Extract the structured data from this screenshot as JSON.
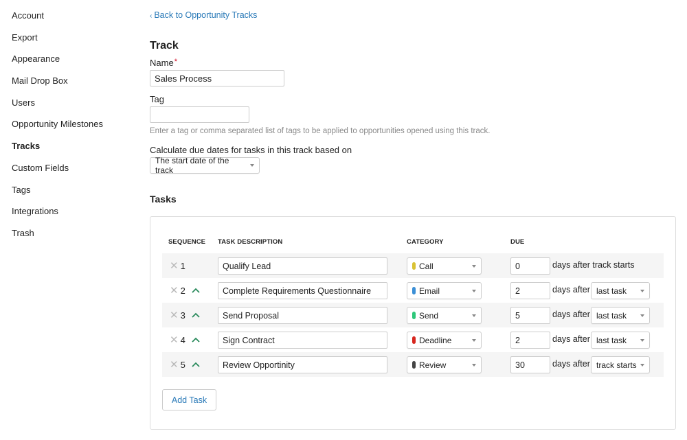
{
  "sidebar": {
    "items": [
      {
        "label": "Account",
        "active": false
      },
      {
        "label": "Export",
        "active": false
      },
      {
        "label": "Appearance",
        "active": false
      },
      {
        "label": "Mail Drop Box",
        "active": false
      },
      {
        "label": "Users",
        "active": false
      },
      {
        "label": "Opportunity Milestones",
        "active": false
      },
      {
        "label": "Tracks",
        "active": true
      },
      {
        "label": "Custom Fields",
        "active": false
      },
      {
        "label": "Tags",
        "active": false
      },
      {
        "label": "Integrations",
        "active": false
      },
      {
        "label": "Trash",
        "active": false
      }
    ]
  },
  "back_link": {
    "chevron": "‹",
    "label": "Back to Opportunity Tracks"
  },
  "form": {
    "heading": "Track",
    "name_label": "Name",
    "required_mark": "*",
    "name_value": "Sales Process",
    "tag_label": "Tag",
    "tag_value": "",
    "tag_help": "Enter a tag or comma separated list of tags to be applied to opportunities opened using this track.",
    "due_basis_label": "Calculate due dates for tasks in this track based on",
    "due_basis_value": "The start date of the track"
  },
  "tasks": {
    "heading": "Tasks",
    "columns": {
      "sequence": "SEQUENCE",
      "description": "TASK DESCRIPTION",
      "category": "CATEGORY",
      "due": "DUE"
    },
    "rows": [
      {
        "seq": "1",
        "description": "Qualify Lead",
        "category": "Call",
        "category_color": "#d9c234",
        "due_days": "0",
        "due_text": "days after track starts",
        "relative_to": null,
        "can_move_up": false
      },
      {
        "seq": "2",
        "description": "Complete Requirements Questionnaire",
        "category": "Email",
        "category_color": "#3b8fd6",
        "due_days": "2",
        "due_text": "days after",
        "relative_to": "last task",
        "can_move_up": true
      },
      {
        "seq": "3",
        "description": "Send Proposal",
        "category": "Send",
        "category_color": "#2ec77a",
        "due_days": "5",
        "due_text": "days after",
        "relative_to": "last task",
        "can_move_up": true
      },
      {
        "seq": "4",
        "description": "Sign Contract",
        "category": "Deadline",
        "category_color": "#d7261e",
        "due_days": "2",
        "due_text": "days after",
        "relative_to": "last task",
        "can_move_up": true
      },
      {
        "seq": "5",
        "description": "Review Opportinity",
        "category": "Review",
        "category_color": "#444444",
        "due_days": "30",
        "due_text": "days after",
        "relative_to": "track starts",
        "can_move_up": true
      }
    ],
    "add_button": "Add Task"
  },
  "icons": {
    "remove": "close-icon",
    "move_up": "chevron-up-icon",
    "dropdown": "caret-down-icon"
  },
  "colors": {
    "link": "#2a7ab8",
    "move_up": "#2a8a5c",
    "required": "#d0021b"
  }
}
